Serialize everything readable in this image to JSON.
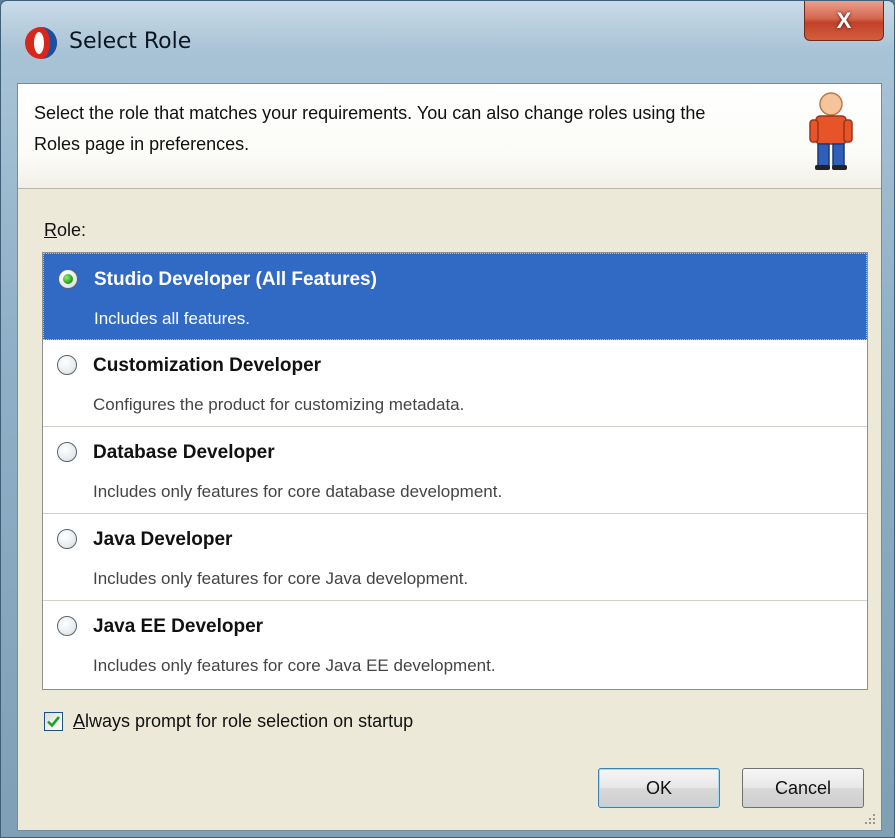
{
  "window": {
    "title": "Select Role",
    "close_label": "X"
  },
  "header": {
    "description": "Select the role that matches your requirements. You can also change roles using the Roles page in preferences."
  },
  "roles_section": {
    "label_accel": "R",
    "label_rest": "ole:",
    "items": [
      {
        "title": "Studio Developer (All Features)",
        "description": "Includes all features.",
        "selected": true
      },
      {
        "title": "Customization Developer",
        "description": "Configures the product for customizing metadata.",
        "selected": false
      },
      {
        "title": "Database Developer",
        "description": "Includes only features for core database development.",
        "selected": false
      },
      {
        "title": "Java Developer",
        "description": "Includes only features for core Java development.",
        "selected": false
      },
      {
        "title": "Java EE Developer",
        "description": "Includes only features for core Java EE development.",
        "selected": false
      }
    ]
  },
  "startup_prompt": {
    "accel": "A",
    "label_rest": "lways prompt for role selection on startup",
    "checked": true
  },
  "buttons": {
    "ok": "OK",
    "cancel": "Cancel"
  },
  "colors": {
    "selection": "#316ac5",
    "close_button": "#c1412a",
    "dialog_face": "#ece9d8"
  },
  "icons": {
    "app": "oracle-jdeveloper-icon",
    "header": "person-icon",
    "close": "close-icon"
  }
}
